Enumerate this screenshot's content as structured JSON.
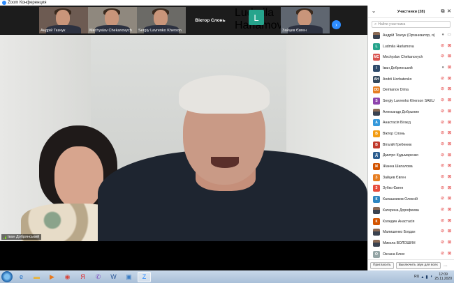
{
  "window": {
    "title": "Zoom Конференция"
  },
  "thumbnails": [
    {
      "kind": "person",
      "name": "Андрій Ткачук",
      "bg": "#6d5b52"
    },
    {
      "kind": "person",
      "name": "Mechyslav Chekanovych",
      "bg": "#8f887e"
    },
    {
      "kind": "person",
      "name": "Sergiy Lavrenko Kherson",
      "bg": "#6b6a66"
    },
    {
      "kind": "name",
      "name": "Віктор Слонь",
      "label": "Віктор Слонь"
    },
    {
      "kind": "avatar",
      "initial": "L",
      "name": "Ludmila Harlamova"
    },
    {
      "kind": "person",
      "name": "Зайцев Євген",
      "bg": "#5f6670"
    }
  ],
  "main_video": {
    "speaker_name": "Іван Добрянський"
  },
  "participants": {
    "title": "Участники (28)",
    "search_placeholder": "Найти участника",
    "items": [
      {
        "name": "Андрій Ткачук (Организатор, я)",
        "avatar": "photo",
        "initials": "",
        "color": "",
        "mic": "on",
        "cam": "on"
      },
      {
        "name": "Ludmila Harlamova",
        "avatar": "initials",
        "initials": "L",
        "color": "#26a48c",
        "mic": "muted",
        "cam": "off"
      },
      {
        "name": "Mechyslav Chekanovych",
        "avatar": "initials",
        "initials": "MC",
        "color": "#d9534f",
        "mic": "muted",
        "cam": "off"
      },
      {
        "name": "Іван Добрянський",
        "avatar": "initials",
        "initials": "І",
        "color": "#2e4a6b",
        "mic": "on",
        "cam": "off"
      },
      {
        "name": "Andrii Horbatenko",
        "avatar": "initials",
        "initials": "AH",
        "color": "#34495e",
        "mic": "muted",
        "cam": "off"
      },
      {
        "name": "Demianov Dima",
        "avatar": "initials",
        "initials": "DD",
        "color": "#e67e22",
        "mic": "muted",
        "cam": "off"
      },
      {
        "name": "Sergiy Lavrenko Kherson SAEU",
        "avatar": "initials",
        "initials": "S",
        "color": "#8e44ad",
        "mic": "muted",
        "cam": "off"
      },
      {
        "name": "Александр Добрынин",
        "avatar": "photo",
        "initials": "",
        "color": "",
        "mic": "muted",
        "cam": "off"
      },
      {
        "name": "Анастасія Бігаєд",
        "avatar": "initials",
        "initials": "А",
        "color": "#3498db",
        "mic": "muted",
        "cam": "off"
      },
      {
        "name": "Віктор Слонь",
        "avatar": "initials",
        "initials": "В",
        "color": "#f39c12",
        "mic": "muted",
        "cam": "off"
      },
      {
        "name": "Віталій Гребенюк",
        "avatar": "initials",
        "initials": "В",
        "color": "#c0392b",
        "mic": "muted",
        "cam": "off"
      },
      {
        "name": "Дмитро Кудьмаренко",
        "avatar": "initials",
        "initials": "Д",
        "color": "#2c5d8f",
        "mic": "muted",
        "cam": "off"
      },
      {
        "name": "Жанна Шапалова",
        "avatar": "initials",
        "initials": "Ж",
        "color": "#d35400",
        "mic": "muted",
        "cam": "off"
      },
      {
        "name": "Зайцев Євген",
        "avatar": "initials",
        "initials": "З",
        "color": "#e67e22",
        "mic": "muted",
        "cam": "off"
      },
      {
        "name": "Зубко Євген",
        "avatar": "initials",
        "initials": "З",
        "color": "#e74c3c",
        "mic": "muted",
        "cam": "off"
      },
      {
        "name": "Калашников Олексій",
        "avatar": "initials",
        "initials": "К",
        "color": "#2e86c1",
        "mic": "muted",
        "cam": "off"
      },
      {
        "name": "Катерина Дорофеева",
        "avatar": "photo",
        "initials": "",
        "color": "",
        "mic": "muted",
        "cam": "off"
      },
      {
        "name": "Коледин Анастасія",
        "avatar": "initials",
        "initials": "К",
        "color": "#d35400",
        "mic": "muted",
        "cam": "off"
      },
      {
        "name": "Малишенко Богдан",
        "avatar": "photo",
        "initials": "",
        "color": "",
        "mic": "muted",
        "cam": "off"
      },
      {
        "name": "Микола ВОЛОШИН",
        "avatar": "photo",
        "initials": "",
        "color": "",
        "mic": "muted",
        "cam": "off"
      },
      {
        "name": "Оксана Клюс",
        "avatar": "initials",
        "initials": "О",
        "color": "#95a5a6",
        "mic": "muted",
        "cam": "off"
      }
    ],
    "footer": {
      "invite_label": "Пригласить",
      "mute_all_label": "Выключить звук для всех"
    }
  },
  "taskbar": {
    "apps": [
      {
        "icon": "ie-icon",
        "glyph": "e",
        "color": "#1f6fc5",
        "active": false
      },
      {
        "icon": "folder-icon",
        "glyph": "▬",
        "color": "#e8b33a",
        "active": false
      },
      {
        "icon": "media-player-icon",
        "glyph": "▶",
        "color": "#e8791d",
        "active": false
      },
      {
        "icon": "chrome-icon",
        "glyph": "◉",
        "color": "#d8433a",
        "active": false
      },
      {
        "icon": "yandex-icon",
        "glyph": "Я",
        "color": "#e02828",
        "active": false
      },
      {
        "icon": "viber-icon",
        "glyph": "✆",
        "color": "#7d4fbf",
        "active": false
      },
      {
        "icon": "word-icon",
        "glyph": "W",
        "color": "#2b5797",
        "active": false
      },
      {
        "icon": "image-viewer-icon",
        "glyph": "▣",
        "color": "#3b7dc4",
        "active": false
      },
      {
        "icon": "zoom-icon",
        "glyph": "Z",
        "color": "#2d8cff",
        "active": true
      }
    ],
    "lang": "RU",
    "time": "12:09",
    "date": "25.11.2020"
  }
}
